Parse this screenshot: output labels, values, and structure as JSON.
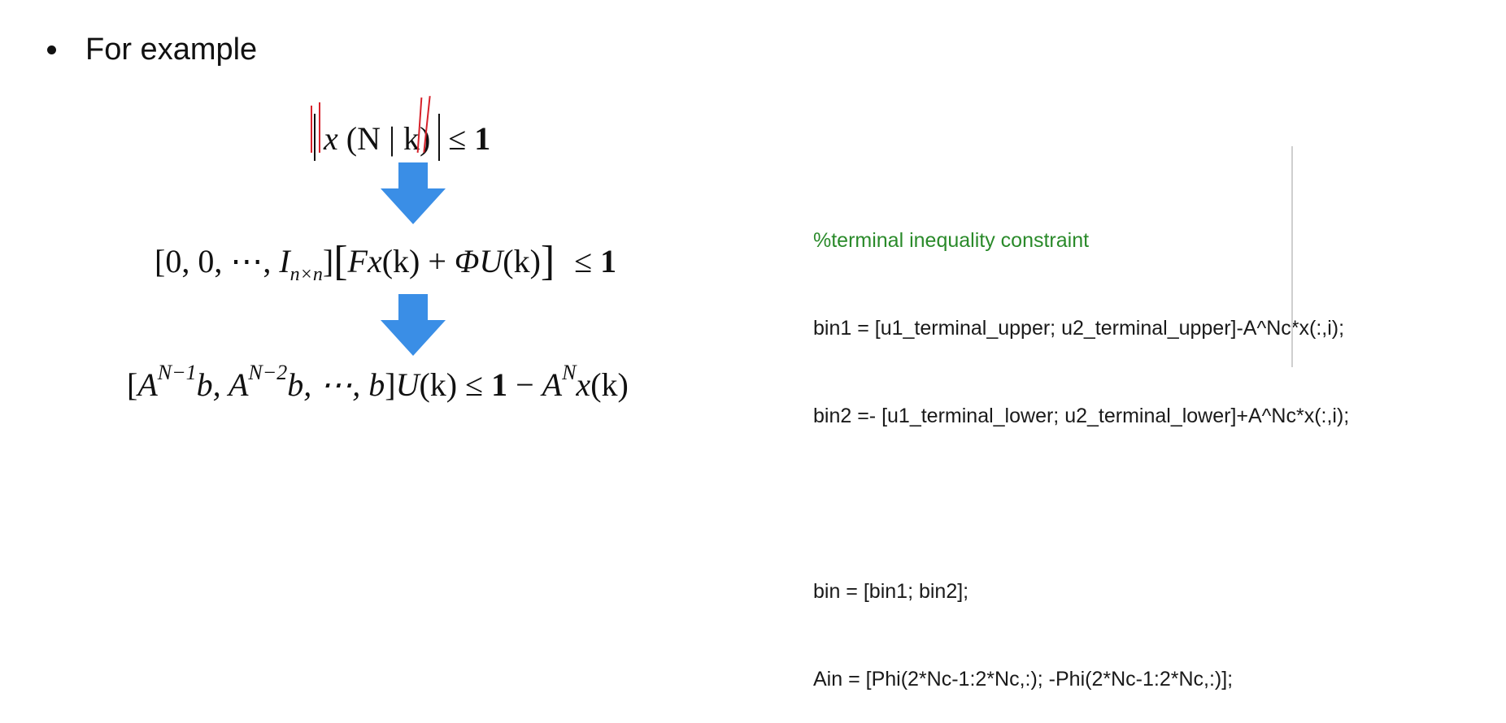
{
  "bullet": {
    "text": "For example"
  },
  "equations": {
    "eq1": {
      "x": "x",
      "args": "(N | k)",
      "rel": "≤",
      "rhs": "1"
    },
    "eq2": {
      "row": "[0, 0,  ⋯, ",
      "I": "I",
      "I_sub": "n×n",
      "close": "]",
      "lbr": "[",
      "F": "Fx",
      "k1": "(k)",
      "plus": " + ",
      "phiU": "ΦU",
      "k2": "(k)",
      "rbr": "]",
      "rel": "≤",
      "rhs": "1"
    },
    "eq3": {
      "open": "[",
      "A1": "A",
      "A1_sup": "N−1",
      "b1": "b, ",
      "A2": "A",
      "A2_sup": "N−2",
      "b2": "b, ⋯, ",
      "b3": "b",
      "close": "]",
      "U": "U",
      "k1": "(k)",
      "rel": "≤",
      "one": "1",
      "minus": "−",
      "A3": "A",
      "A3_sup": "N",
      "x": "x",
      "k2": "(k)"
    }
  },
  "code": {
    "comment": "%terminal inequality constraint",
    "line1": "bin1 = [u1_terminal_upper; u2_terminal_upper]-A^Nc*x(:,i);",
    "line2": "bin2 =- [u1_terminal_lower; u2_terminal_lower]+A^Nc*x(:,i);",
    "line3": "",
    "line4": "bin = [bin1; bin2];",
    "line5": "Ain = [Phi(2*Nc-1:2*Nc,:); -Phi(2*Nc-1:2*Nc,:)];"
  },
  "colors": {
    "arrow": "#3a8ee6",
    "comment": "#2a8a2a",
    "annotation": "#d6212a"
  }
}
